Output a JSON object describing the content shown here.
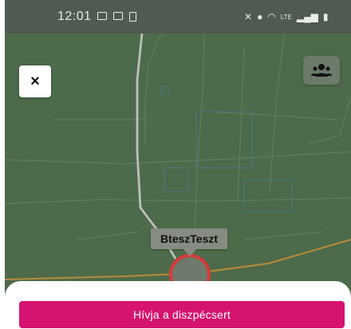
{
  "status_bar": {
    "time": "12:01",
    "left_icons": [
      "image-icon",
      "media-icon",
      "phone-icon"
    ],
    "right_icons": [
      "mute-icon",
      "location-icon",
      "wifi-icon",
      "signal-icon",
      "battery-icon"
    ],
    "network_text": "LTE"
  },
  "map": {
    "marker_label": "BteszTeszt",
    "marker_color": "#d63a3a"
  },
  "controls": {
    "close_symbol": "×",
    "users_icon": "group-icon"
  },
  "bottom_sheet": {
    "call_button_label": "Hívja a diszpécsert",
    "call_button_color": "#d6136e"
  }
}
